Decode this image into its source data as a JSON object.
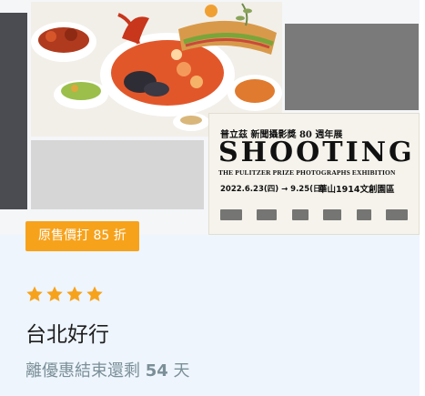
{
  "badge": {
    "label": "原售價打 85 折"
  },
  "rating": {
    "stars": 4
  },
  "product": {
    "title": "台北好行"
  },
  "countdown": {
    "prefix": "離優惠結束還剩 ",
    "days": "54",
    "suffix": " 天"
  },
  "poster": {
    "cn_title": "普立茲 新聞攝影獎 80 週年展",
    "headline": "SHOOTING",
    "subtitle": "THE PULITZER PRIZE PHOTOGRAPHS EXHIBITION",
    "dates": "2022.6.23(四) → 9.25(日)",
    "venue": "華山1914文創園區"
  },
  "colors": {
    "badge": "#f7a21b",
    "star": "#f7a21b",
    "countdown": "#7b8f97"
  }
}
